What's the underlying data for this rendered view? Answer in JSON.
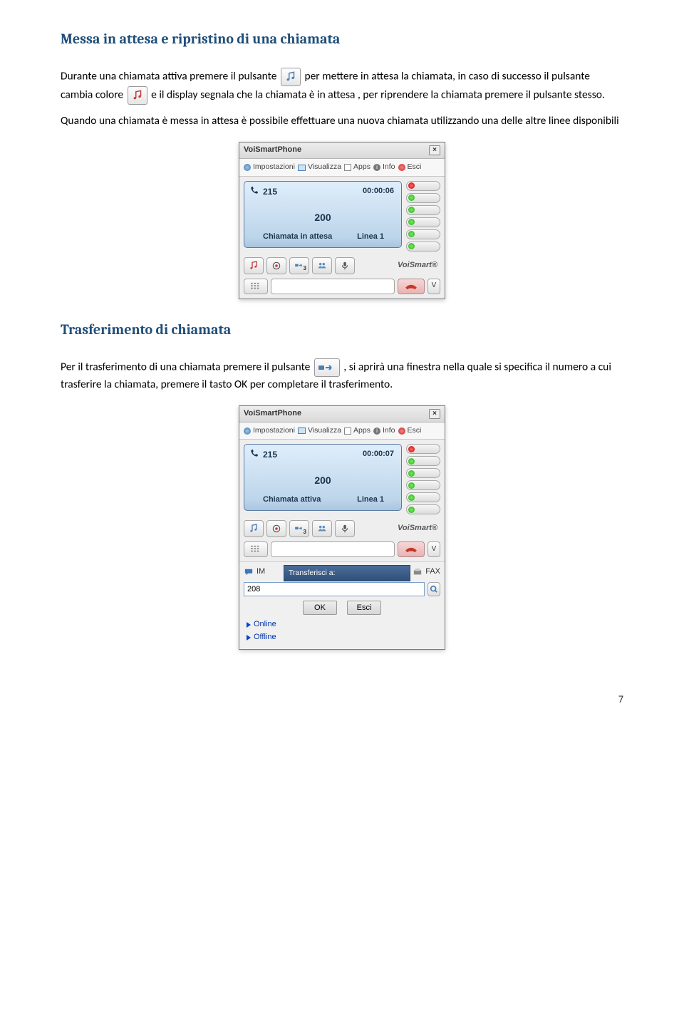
{
  "section1": {
    "heading": "Messa in attesa e ripristino di una chiamata",
    "p1a": "Durante una chiamata attiva premere il pulsante ",
    "p1b": " per mettere in attesa la chiamata, in caso di successo il pulsante cambia colore ",
    "p1c": " e il display segnala che la chiamata è in attesa , per riprendere la chiamata premere il pulsante stesso.",
    "p2": "Quando una chiamata è messa in attesa è possibile effettuare una nuova chiamata utilizzando una delle altre linee disponibili"
  },
  "softphone1": {
    "title": "VoiSmartPhone",
    "menu": {
      "impostazioni": "Impostazioni",
      "visualizza": "Visualizza",
      "apps": "Apps",
      "info": "Info",
      "esci": "Esci"
    },
    "ext": "215",
    "timer": "00:00:06",
    "number": "200",
    "status": "Chiamata in attesa",
    "linea": "Linea 1",
    "brand": "VoiSmart®",
    "v_label": "V"
  },
  "section2": {
    "heading": "Trasferimento di chiamata",
    "p1a": "Per il trasferimento di una chiamata premere il pulsante ",
    "p1b": " , si aprirà una finestra nella quale si specifica il numero a cui trasferire la chiamata, premere il tasto OK per completare il trasferimento."
  },
  "softphone2": {
    "title": "VoiSmartPhone",
    "menu": {
      "impostazioni": "Impostazioni",
      "visualizza": "Visualizza",
      "apps": "Apps",
      "info": "Info",
      "esci": "Esci"
    },
    "ext": "215",
    "timer": "00:00:07",
    "number": "200",
    "status": "Chiamata attiva",
    "linea": "Linea 1",
    "brand": "VoiSmart®",
    "v_label": "V",
    "tabs": {
      "im": "IM",
      "fax": "FAX"
    },
    "transfer_label": "Transferisci a:",
    "transfer_value": "208",
    "ok": "OK",
    "esci": "Esci",
    "online": "Online",
    "offline": "Offline"
  },
  "page_number": "7"
}
